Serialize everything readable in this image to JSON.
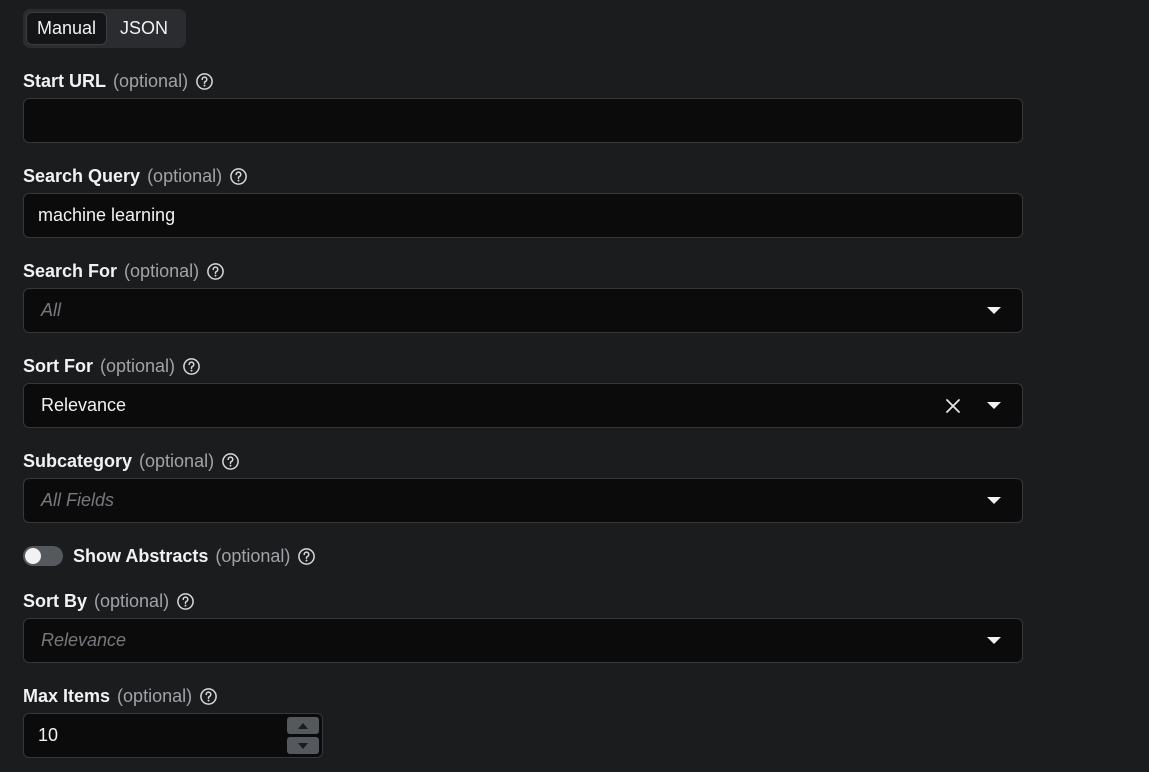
{
  "mode_switch": {
    "manual_label": "Manual",
    "json_label": "JSON",
    "active": "Manual"
  },
  "fields": {
    "start_url": {
      "label": "Start URL",
      "optional": "(optional)",
      "value": ""
    },
    "search_query": {
      "label": "Search Query",
      "optional": "(optional)",
      "value": "machine learning"
    },
    "search_for": {
      "label": "Search For",
      "optional": "(optional)",
      "placeholder": "All"
    },
    "sort_for": {
      "label": "Sort For",
      "optional": "(optional)",
      "value": "Relevance"
    },
    "subcategory": {
      "label": "Subcategory",
      "optional": "(optional)",
      "placeholder": "All Fields"
    },
    "show_abstracts": {
      "label": "Show Abstracts",
      "optional": "(optional)",
      "enabled": false
    },
    "sort_by": {
      "label": "Sort By",
      "optional": "(optional)",
      "placeholder": "Relevance"
    },
    "max_items": {
      "label": "Max Items",
      "optional": "(optional)",
      "value": "10"
    }
  },
  "icons": {
    "help": "question-circle-icon",
    "dropdown": "caret-down-icon",
    "clear": "close-icon"
  },
  "colors": {
    "background": "#1b1c1e",
    "field_bg": "#0b0b0b",
    "border": "#35373b",
    "muted": "#a0a3a8"
  }
}
